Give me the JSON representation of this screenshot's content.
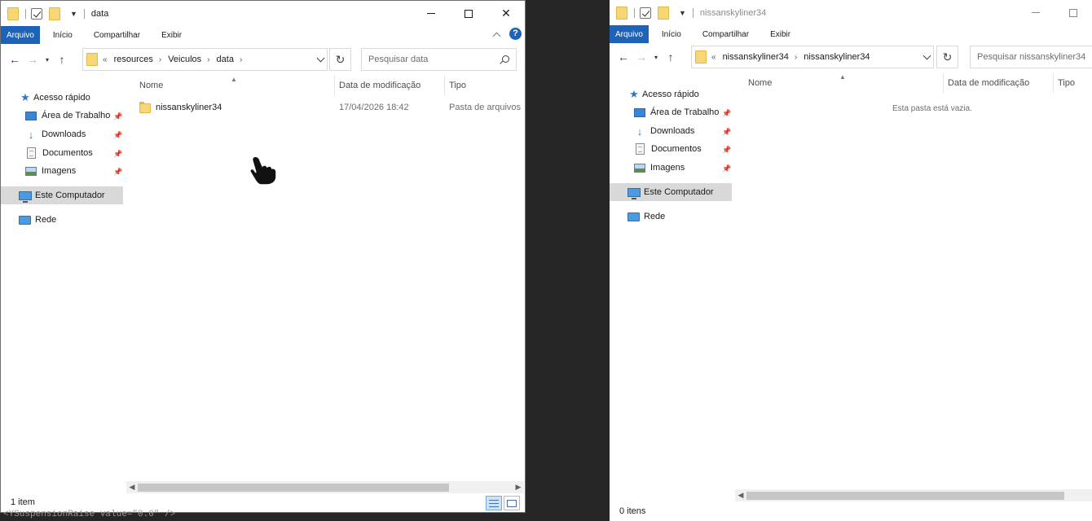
{
  "left_window": {
    "title": "data",
    "ribbon_tabs": [
      "Arquivo",
      "Início",
      "Compartilhar",
      "Exibir"
    ],
    "help_label": "?",
    "breadcrumb_lead": "«",
    "breadcrumb": [
      "resources",
      "Veiculos",
      "data"
    ],
    "breadcrumb_separator": "›",
    "search_placeholder": "Pesquisar data",
    "nav": {
      "quick_access": "Acesso rápido",
      "items": [
        "Área de Trabalho",
        "Downloads",
        "Documentos",
        "Imagens"
      ],
      "this_pc": "Este Computador",
      "network": "Rede"
    },
    "columns": [
      "Nome",
      "Data de modificação",
      "Tipo"
    ],
    "rows": [
      {
        "name": "nissanskyliner34",
        "modified": "17/04/2026 18:42",
        "type": "Pasta de arquivos"
      }
    ],
    "status": "1 item",
    "scrollbar": {
      "thumb_start_fraction": 0.0,
      "thumb_fraction": 0.83
    }
  },
  "right_window": {
    "title": "nissanskyliner34",
    "ribbon_tabs": [
      "Arquivo",
      "Início",
      "Compartilhar",
      "Exibir"
    ],
    "breadcrumb_lead": "«",
    "breadcrumb": [
      "nissanskyliner34",
      "nissanskyliner34"
    ],
    "breadcrumb_separator": "›",
    "search_placeholder": "Pesquisar nissanskyliner34",
    "nav": {
      "quick_access": "Acesso rápido",
      "items": [
        "Área de Trabalho",
        "Downloads",
        "Documentos",
        "Imagens"
      ],
      "this_pc": "Este Computador",
      "network": "Rede"
    },
    "columns": [
      "Nome",
      "Data de modificação",
      "Tipo"
    ],
    "empty_message": "Esta pasta está vazia.",
    "status": "0 itens",
    "scrollbar": {
      "thumb_start_fraction": 0.0,
      "thumb_fraction": 0.95
    }
  },
  "background_code": "<YSuspensionRaise value=\"0.0\" />",
  "colors": {
    "accent": "#1e63b8",
    "folder": "#f7d674",
    "selected_nav": "#d9d9d9"
  }
}
